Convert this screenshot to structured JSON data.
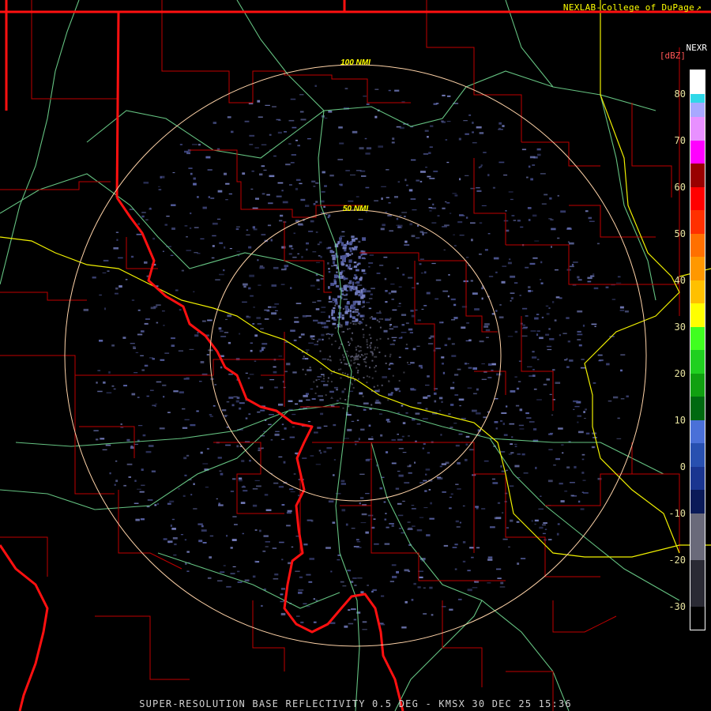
{
  "credit": {
    "text": "NEXLAB-College of DuPage",
    "link_icon": "external-link-icon"
  },
  "product_label": "NEXR",
  "units_label": "[dBZ]",
  "colors": {
    "credit": "#ffff00",
    "units": "#ff5555",
    "footer": "#cfcfcf",
    "ticks": "#e8e4a0",
    "state_border": "#ff1010",
    "county_border": "#c00000",
    "interstate": "#f0f000",
    "highway": "#70d890",
    "range_ring": "#ffd3a8",
    "echo": "#6e78b8",
    "ring_label": "#ffff00"
  },
  "range_rings": [
    {
      "label": "100 NMI"
    },
    {
      "label": "50 NMI"
    }
  ],
  "color_scale": {
    "ticks": [
      "80",
      "70",
      "60",
      "50",
      "40",
      "30",
      "20",
      "10",
      "0",
      "-10",
      "-20",
      "-30"
    ],
    "min_dbz": -35,
    "max_dbz": 85,
    "bands": [
      {
        "from": 80,
        "to": 85,
        "color": "#ffffff"
      },
      {
        "from": 78,
        "to": 80,
        "color": "#30d8e8"
      },
      {
        "from": 75,
        "to": 78,
        "color": "#a8a8ff"
      },
      {
        "from": 70,
        "to": 75,
        "color": "#e890ff"
      },
      {
        "from": 65,
        "to": 70,
        "color": "#ff00ff"
      },
      {
        "from": 60,
        "to": 65,
        "color": "#990000"
      },
      {
        "from": 55,
        "to": 60,
        "color": "#ff0000"
      },
      {
        "from": 50,
        "to": 55,
        "color": "#ff3000"
      },
      {
        "from": 45,
        "to": 50,
        "color": "#ff7000"
      },
      {
        "from": 40,
        "to": 45,
        "color": "#ff9800"
      },
      {
        "from": 35,
        "to": 40,
        "color": "#ffc000"
      },
      {
        "from": 30,
        "to": 35,
        "color": "#ffff00"
      },
      {
        "from": 25,
        "to": 30,
        "color": "#40ff20"
      },
      {
        "from": 20,
        "to": 25,
        "color": "#20d020"
      },
      {
        "from": 15,
        "to": 20,
        "color": "#10a010"
      },
      {
        "from": 10,
        "to": 15,
        "color": "#006a10"
      },
      {
        "from": 5,
        "to": 10,
        "color": "#4a70d8"
      },
      {
        "from": 0,
        "to": 5,
        "color": "#2850b0"
      },
      {
        "from": -5,
        "to": 0,
        "color": "#1a3590"
      },
      {
        "from": -10,
        "to": -5,
        "color": "#0a1a58"
      },
      {
        "from": -20,
        "to": -10,
        "color": "#6a6a7a"
      },
      {
        "from": -30,
        "to": -20,
        "color": "#2a2a34"
      },
      {
        "from": -35,
        "to": -30,
        "color": "#000000"
      }
    ]
  },
  "footer": "SUPER-RESOLUTION BASE REFLECTIVITY 0.5 DEG - KMSX 30 DEC 25 15:36"
}
